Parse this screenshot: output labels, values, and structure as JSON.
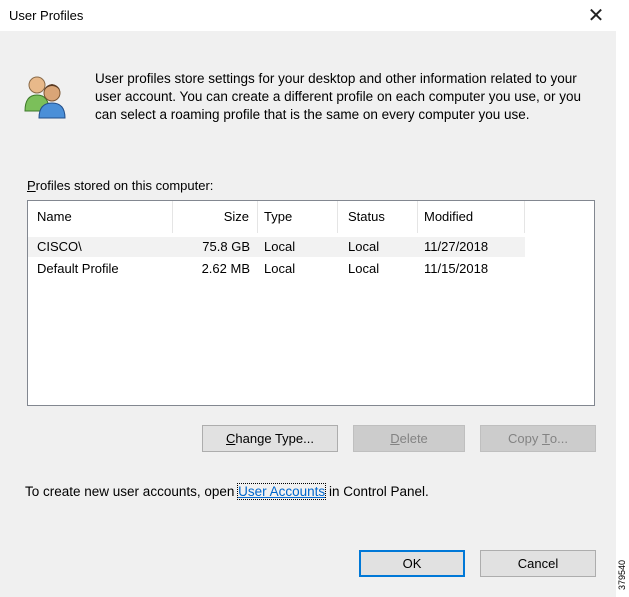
{
  "window": {
    "title": "User Profiles",
    "close_glyph": "✕"
  },
  "intro": {
    "text": "User profiles store settings for your desktop and other information related to your user account. You can create a different profile on each computer you use, or you can select a roaming profile that is the same on every computer you use.",
    "icon": "users-icon"
  },
  "profiles_label": {
    "mnemonic": "P",
    "rest": "rofiles stored on this computer:"
  },
  "table": {
    "columns": [
      "Name",
      "Size",
      "Type",
      "Status",
      "Modified"
    ],
    "rows": [
      [
        "CISCO\\",
        "75.8 GB",
        "Local",
        "Local",
        "11/27/2018"
      ],
      [
        "Default Profile",
        "2.62 MB",
        "Local",
        "Local",
        "11/15/2018"
      ]
    ]
  },
  "buttons": {
    "change_type": {
      "mnemonic": "C",
      "rest": "hange Type..."
    },
    "delete": {
      "mnemonic": "D",
      "rest": "elete"
    },
    "copy_to": {
      "before": "Copy ",
      "mnemonic": "T",
      "rest": "o..."
    },
    "ok": "OK",
    "cancel": "Cancel"
  },
  "footer": {
    "before": "To create new user accounts, open ",
    "link": "User Accounts",
    "after": " in Control Panel."
  },
  "side_label": "379540",
  "colors": {
    "link": "#0066cc",
    "focus_border": "#0078d7",
    "panel": "#f0f0f0"
  }
}
